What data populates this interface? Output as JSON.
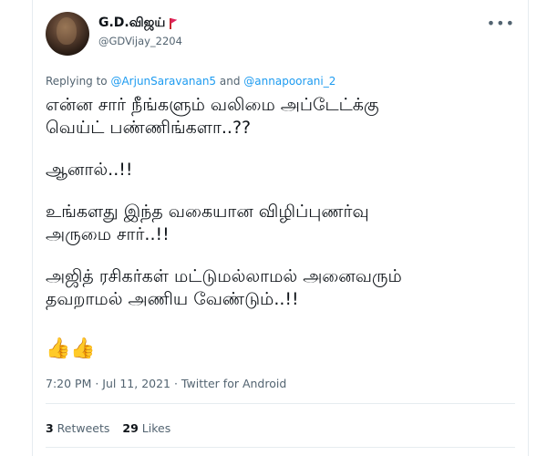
{
  "author": {
    "display_name": "G.D.விஜய்",
    "handle": "@GDVijay_2204",
    "flag_emoji": "🚩"
  },
  "reply": {
    "prefix": "Replying to ",
    "user1": "@ArjunSaravanan5",
    "and": " and ",
    "user2": "@annapoorani_2"
  },
  "body": {
    "p1": "என்ன சார் நீங்களும் வலிமை அப்டேட்க்கு\nவெய்ட் பண்ணிங்களா..??",
    "p2": "ஆனால்..!!",
    "p3": "உங்களது இந்த வகையான விழிப்புணர்வு\nஅருமை சார்..!!",
    "p4": "அஜித் ரசிகர்கள் மட்டுமல்லாமல் அனைவரும்\nதவறாமல் அணிய வேண்டும்..!!",
    "emoji": "👍👍"
  },
  "meta": {
    "text": "7:20 PM · Jul 11, 2021 · Twitter for Android"
  },
  "stats": {
    "retweets_count": "3",
    "retweets_label": " Retweets",
    "likes_count": "29",
    "likes_label": " Likes"
  },
  "icons": {
    "more": "more-options-icon",
    "flag": "red-flag-icon"
  },
  "colors": {
    "link": "#1d9bf0",
    "text": "#0f1419",
    "secondary": "#536471",
    "divider": "#e6ecf0"
  }
}
